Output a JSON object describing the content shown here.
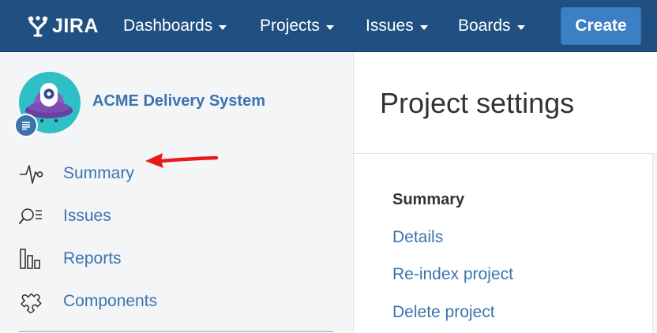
{
  "nav": {
    "logo_text": "JIRA",
    "items": [
      {
        "label": "Dashboards"
      },
      {
        "label": "Projects"
      },
      {
        "label": "Issues"
      },
      {
        "label": "Boards"
      }
    ],
    "create_label": "Create"
  },
  "sidebar": {
    "project_name": "ACME Delivery System",
    "items": [
      {
        "label": "Summary",
        "icon": "activity-icon"
      },
      {
        "label": "Issues",
        "icon": "issues-search-icon"
      },
      {
        "label": "Reports",
        "icon": "reports-bar-icon"
      },
      {
        "label": "Components",
        "icon": "puzzle-icon"
      }
    ]
  },
  "main": {
    "title": "Project settings",
    "menu_heading": "Summary",
    "links": [
      {
        "label": "Details"
      },
      {
        "label": "Re-index project"
      },
      {
        "label": "Delete project"
      }
    ]
  },
  "colors": {
    "nav_bg": "#205081",
    "create_bg": "#3b7fc4",
    "link": "#3b73af",
    "arrow": "#e8191a"
  }
}
